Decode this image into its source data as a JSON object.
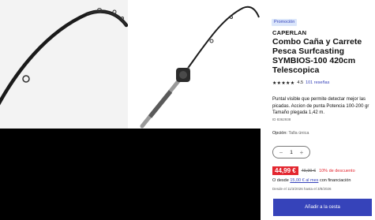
{
  "product": {
    "badge": "Promoción",
    "brand": "CAPERLAN",
    "title": "Combo Caña y Carrete Pesca Surfcasting SYMBIOS-100 420cm Telescopica",
    "rating": {
      "stars": "★★★★★",
      "value": "4.5",
      "reviews_label": "101 reseñas"
    },
    "description": "Puntal visible que permite detectar mejor las picadas. Accion de punta Potencia 100-200 gr Tamaño plegada 1,42 m.",
    "sku": "ID 8362938",
    "option": {
      "label": "Opción:",
      "value": "Talla única"
    },
    "quantity": {
      "minus": "−",
      "value": "1",
      "plus": "+"
    },
    "price": {
      "current": "44,99 €",
      "original": "49,99 €",
      "discount": "10% de descuento"
    },
    "finance": {
      "prefix": "O desde",
      "link": "15,00 € al mes",
      "suffix": "con financiación"
    },
    "validity": "Desde el 11/3/2026 hasta el 3/8/2026",
    "cta_label": "Añadir a la cesta"
  },
  "colors": {
    "accent": "#3643ba",
    "sale": "#e3262f",
    "badge_bg": "#dbe6fb"
  }
}
